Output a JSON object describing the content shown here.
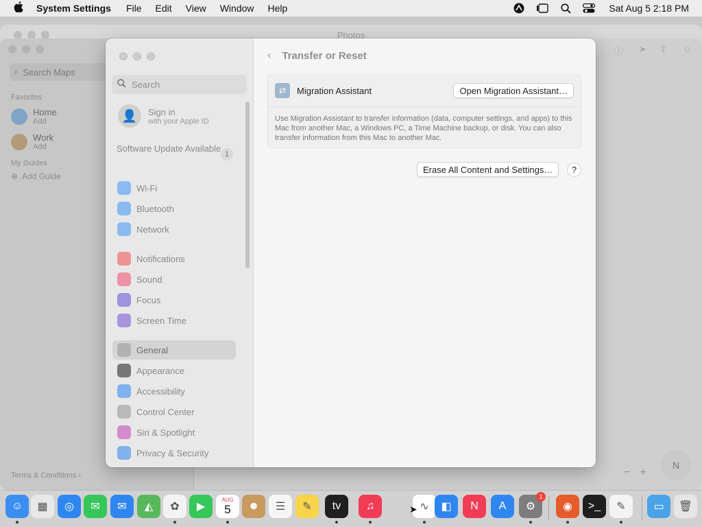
{
  "menubar": {
    "apple": "",
    "app_name": "System Settings",
    "menus": [
      "File",
      "Edit",
      "View",
      "Window",
      "Help"
    ],
    "clock": "Sat Aug 5  2:18 PM"
  },
  "bg_photos": {
    "title": "Photos"
  },
  "bg_maps": {
    "search_placeholder": "Search Maps",
    "favorites_label": "Favorites",
    "items": [
      {
        "name": "Home",
        "sub": "Add"
      },
      {
        "name": "Work",
        "sub": "Add"
      }
    ],
    "guides_label": "My Guides",
    "add_guide": "Add Guide",
    "terms": "Terms & Conditions",
    "compass": "N"
  },
  "sidebar": {
    "search_placeholder": "Search",
    "signin_title": "Sign in",
    "signin_sub": "with your Apple ID",
    "software_update": "Software Update Available",
    "software_update_count": "1",
    "items": [
      {
        "label": "Wi-Fi",
        "icon": "wifi-icon",
        "color": "#4a9cf5"
      },
      {
        "label": "Bluetooth",
        "icon": "bluetooth-icon",
        "color": "#4a9cf5"
      },
      {
        "label": "Network",
        "icon": "globe-icon",
        "color": "#4a9cf5"
      },
      {
        "label": "Notifications",
        "icon": "bell-icon",
        "color": "#f25a5a"
      },
      {
        "label": "Sound",
        "icon": "speaker-icon",
        "color": "#f25a7a"
      },
      {
        "label": "Focus",
        "icon": "moon-icon",
        "color": "#6a5cd6"
      },
      {
        "label": "Screen Time",
        "icon": "hourglass-icon",
        "color": "#7b5cd6"
      },
      {
        "label": "General",
        "icon": "gear-icon",
        "color": "#9a9a9a"
      },
      {
        "label": "Appearance",
        "icon": "appearance-icon",
        "color": "#2a2a2a"
      },
      {
        "label": "Accessibility",
        "icon": "accessibility-icon",
        "color": "#3d8cf0"
      },
      {
        "label": "Control Center",
        "icon": "control-center-icon",
        "color": "#9a9a9a"
      },
      {
        "label": "Siri & Spotlight",
        "icon": "siri-icon",
        "color": "#c54dbd"
      },
      {
        "label": "Privacy & Security",
        "icon": "hand-icon",
        "color": "#3d8cf0"
      }
    ],
    "active": "General"
  },
  "content": {
    "title": "Transfer or Reset",
    "migration_name": "Migration Assistant",
    "open_migration_button": "Open Migration Assistant…",
    "migration_desc": "Use Migration Assistant to transfer information (data, computer settings, and apps) to this Mac from another Mac, a Windows PC, a Time Machine backup, or disk. You can also transfer information from this Mac to another Mac.",
    "erase_button": "Erase All Content and Settings…",
    "help_button": "?"
  },
  "dock": {
    "calendar_month": "AUG",
    "calendar_day": "5",
    "settings_badge": "1",
    "apps": [
      {
        "name": "finder-icon",
        "color": "#3b8ef0",
        "glyph": "☺"
      },
      {
        "name": "launchpad-icon",
        "color": "#e8e8e8",
        "glyph": "▦"
      },
      {
        "name": "safari-icon",
        "color": "#2e86f0",
        "glyph": "◎"
      },
      {
        "name": "messages-icon",
        "color": "#35c75a",
        "glyph": "✉"
      },
      {
        "name": "mail-icon",
        "color": "#2f86f0",
        "glyph": "✉"
      },
      {
        "name": "maps-icon",
        "color": "#5ab85c",
        "glyph": "◭"
      },
      {
        "name": "photos-icon",
        "color": "#f3f3f3",
        "glyph": "✿"
      },
      {
        "name": "facetime-icon",
        "color": "#35c75a",
        "glyph": "▶"
      },
      {
        "name": "calendar-icon",
        "color": "#ffffff",
        "glyph": ""
      },
      {
        "name": "contacts-icon",
        "color": "#c89a5e",
        "glyph": "☻"
      },
      {
        "name": "reminders-icon",
        "color": "#f6f6f6",
        "glyph": "☰"
      },
      {
        "name": "notes-icon",
        "color": "#f7d44a",
        "glyph": "✎"
      },
      {
        "name": "tv-icon",
        "color": "#1f1f1f",
        "glyph": "tv"
      },
      {
        "name": "music-icon",
        "color": "#f23c55",
        "glyph": "♫"
      },
      {
        "name": "freeform-icon",
        "color": "#ffffff",
        "glyph": "∿"
      },
      {
        "name": "keynote-icon",
        "color": "#2f86f0",
        "glyph": "◧"
      },
      {
        "name": "news-icon",
        "color": "#f23c55",
        "glyph": "N"
      },
      {
        "name": "app-store-icon",
        "color": "#2f86f0",
        "glyph": "A"
      },
      {
        "name": "system-settings-icon",
        "color": "#7d7d7d",
        "glyph": "⚙"
      },
      {
        "name": "firefox-icon",
        "color": "#e55b2a",
        "glyph": "◉"
      },
      {
        "name": "terminal-icon",
        "color": "#1f1f1f",
        "glyph": ">_"
      },
      {
        "name": "textedit-icon",
        "color": "#f3f3f3",
        "glyph": "✎"
      },
      {
        "name": "downloads-folder-icon",
        "color": "#4aa3e8",
        "glyph": "▭"
      },
      {
        "name": "trash-icon",
        "color": "#e6e6e6",
        "glyph": "🗑"
      }
    ]
  }
}
